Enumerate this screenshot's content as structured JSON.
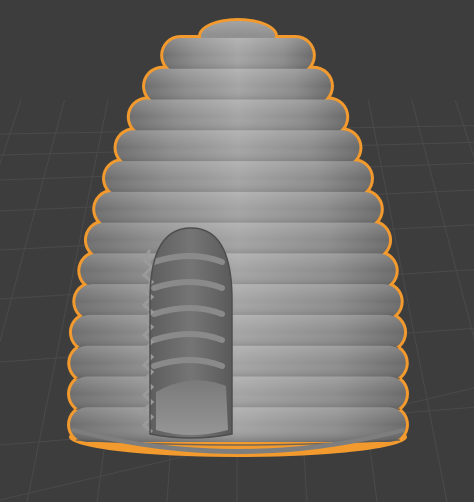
{
  "viewport": {
    "type": "3d-viewport",
    "shading": "solid",
    "background_color": "#3d3d3d",
    "grid_line_color": "#4a4a4a",
    "grid_visible": true
  },
  "object": {
    "name_shown": false,
    "shape": "beehive-skep",
    "selected": true,
    "selection_outline_color": "#f29a2e",
    "surface_color": "#8f8f8f",
    "ring_count": 13,
    "has_doorway": true
  }
}
